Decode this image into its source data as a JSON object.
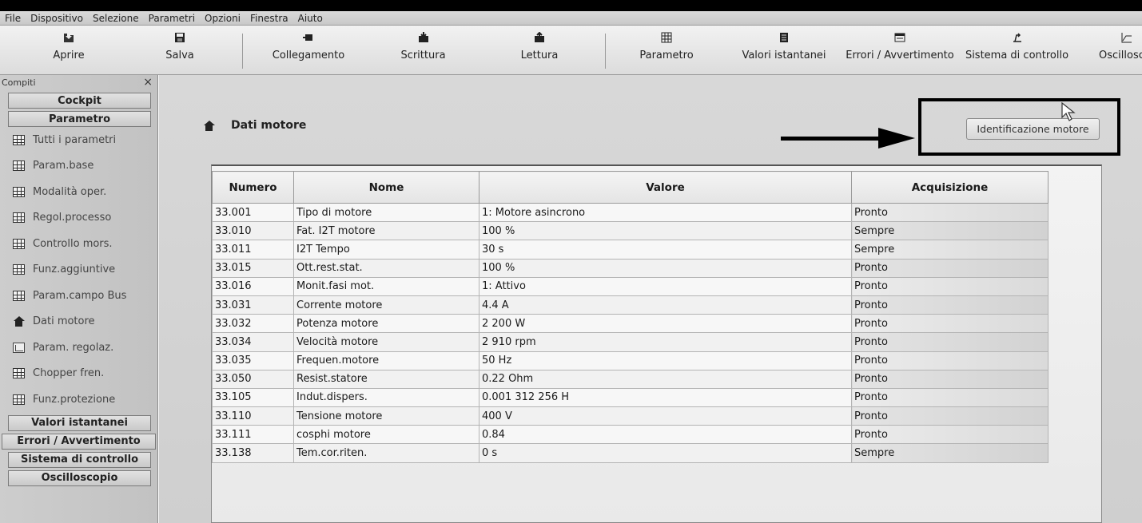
{
  "menu": [
    "File",
    "Dispositivo",
    "Selezione",
    "Parametri",
    "Opzioni",
    "Finestra",
    "Aiuto"
  ],
  "toolbar": {
    "open": "Aprire",
    "save": "Salva",
    "connect": "Collegamento",
    "write": "Scrittura",
    "read": "Lettura",
    "parameter": "Parametro",
    "actual_values": "Valori istantanei",
    "errors": "Errori / Avvertimento",
    "control_system": "Sistema di controllo",
    "oscilloscope": "Oscillosc"
  },
  "sidebar": {
    "title": "Compiti",
    "close": "×",
    "cat_cockpit": "Cockpit",
    "cat_parametro": "Parametro",
    "items": [
      "Tutti i parametri",
      "Param.base",
      "Modalità oper.",
      "Regol.processo",
      "Controllo mors.",
      "Funz.aggiuntive",
      "Param.campo Bus",
      "Dati motore",
      "Param. regolaz.",
      "Chopper fren.",
      "Funz.protezione"
    ],
    "cat_values": "Valori istantanei",
    "cat_errors": "Errori / Avvertimento",
    "cat_control": "Sistema di controllo",
    "cat_osc": "Oscilloscopio"
  },
  "main": {
    "section_title": "Dati motore",
    "ident_button": "Identificazione motore",
    "headers": {
      "number": "Numero",
      "name": "Nome",
      "value": "Valore",
      "acquisition": "Acquisizione"
    },
    "rows": [
      [
        "33.001",
        "Tipo di motore",
        "1: Motore asincrono",
        "Pronto"
      ],
      [
        "33.010",
        "Fat. I2T motore",
        "100 %",
        "Sempre"
      ],
      [
        "33.011",
        "I2T Tempo",
        "30 s",
        "Sempre"
      ],
      [
        "33.015",
        "Ott.rest.stat.",
        "100 %",
        "Pronto"
      ],
      [
        "33.016",
        "Monit.fasi mot.",
        "1: Attivo",
        "Pronto"
      ],
      [
        "33.031",
        "Corrente motore",
        "4.4 A",
        "Pronto"
      ],
      [
        "33.032",
        "Potenza motore",
        "2 200 W",
        "Pronto"
      ],
      [
        "33.034",
        "Velocità motore",
        "2 910 rpm",
        "Pronto"
      ],
      [
        "33.035",
        "Frequen.motore",
        "50 Hz",
        "Pronto"
      ],
      [
        "33.050",
        "Resist.statore",
        "0.22 Ohm",
        "Pronto"
      ],
      [
        "33.105",
        "Indut.dispers.",
        "0.001 312 256 H",
        "Pronto"
      ],
      [
        "33.110",
        "Tensione motore",
        "400 V",
        "Pronto"
      ],
      [
        "33.111",
        "cosphi motore",
        "0.84",
        "Pronto"
      ],
      [
        "33.138",
        "Tem.cor.riten.",
        "0 s",
        "Sempre"
      ]
    ]
  }
}
